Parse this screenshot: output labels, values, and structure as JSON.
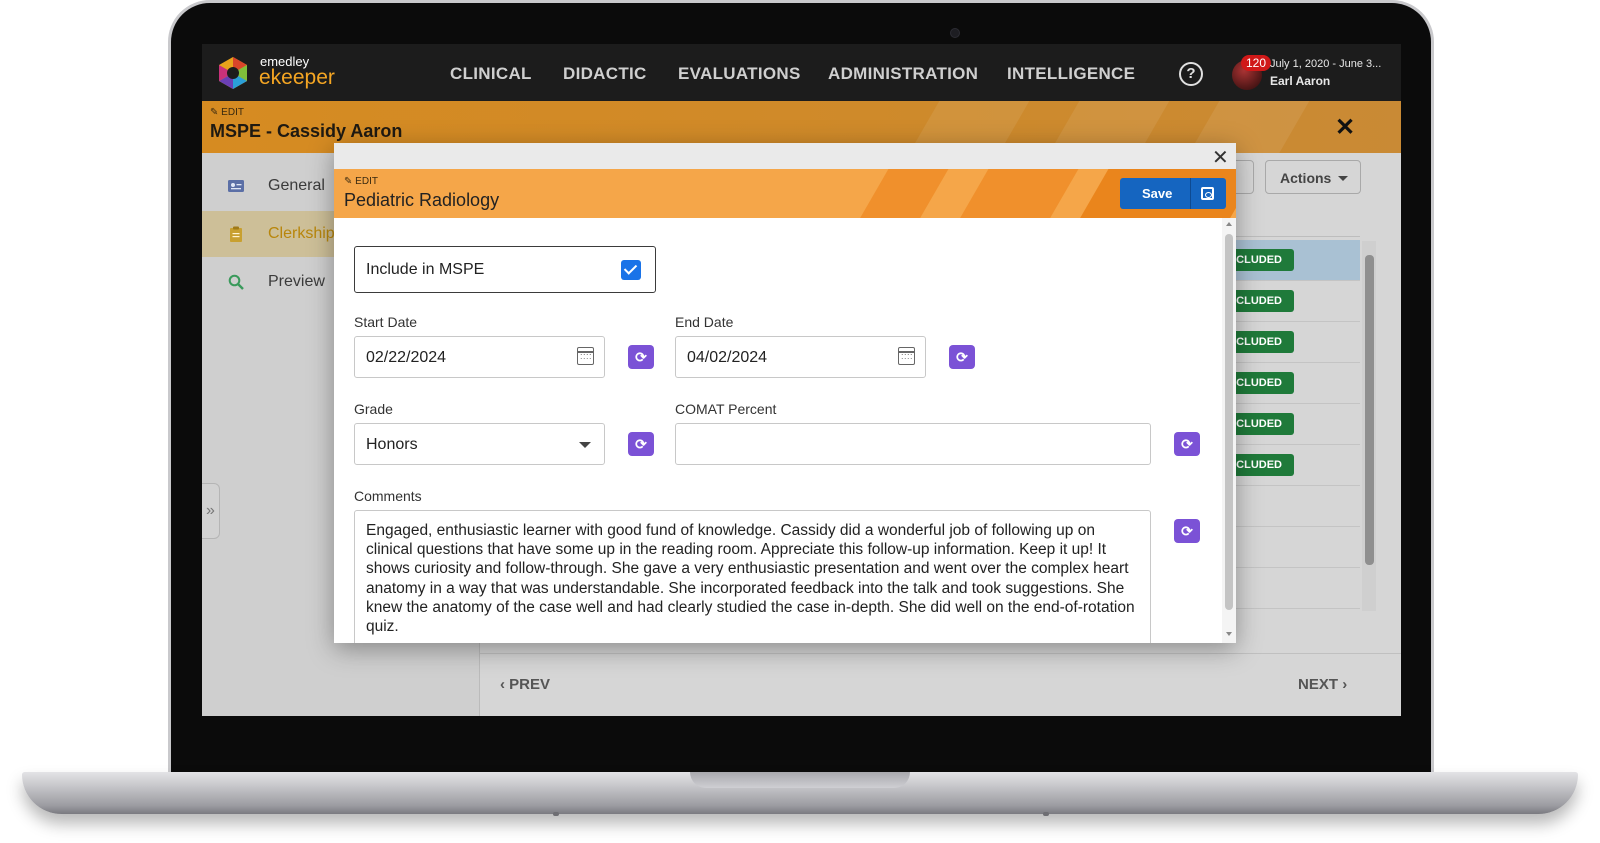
{
  "app": {
    "brand_top": "emedley",
    "brand_main": "ekeeper"
  },
  "nav": {
    "items": [
      "CLINICAL",
      "DIDACTIC",
      "EVALUATIONS",
      "ADMINISTRATION",
      "INTELLIGENCE"
    ],
    "help_icon": "?",
    "notification_count": "120",
    "date_range": "July 1, 2020 - June 3...",
    "user_name": "Earl Aaron"
  },
  "page": {
    "edit_tag": "EDIT",
    "title": "MSPE - Cassidy Aaron",
    "close_icon": "✕"
  },
  "sidebar": {
    "items": [
      {
        "label": "General",
        "icon": "id-card-icon"
      },
      {
        "label": "Clerkships",
        "icon": "clipboard-icon"
      },
      {
        "label": "Preview",
        "icon": "search-icon"
      }
    ],
    "collapse_icon": "»"
  },
  "main": {
    "actions_label": "Actions",
    "badges": [
      "INCLUDED",
      "INCLUDED",
      "INCLUDED",
      "INCLUDED",
      "INCLUDED",
      "INCLUDED"
    ],
    "prev_label": "PREV",
    "next_label": "NEXT",
    "prev_icon": "‹",
    "next_icon": "›"
  },
  "modal": {
    "close_icon": "✕",
    "edit_tag": "EDIT",
    "title": "Pediatric Radiology",
    "save_label": "Save",
    "include_label": "Include in MSPE",
    "include_checked": true,
    "start_date_label": "Start Date",
    "start_date": "02/22/2024",
    "end_date_label": "End Date",
    "end_date": "04/02/2024",
    "grade_label": "Grade",
    "grade_value": "Honors",
    "comat_label": "COMAT Percent",
    "comat_value": "",
    "comments_label": "Comments",
    "comments": "Engaged, enthusiastic learner with good fund of knowledge. Cassidy did a wonderful job of following up on clinical questions that have some up in the reading room. Appreciate this follow-up information. Keep it up! It shows curiosity  and follow-through. She gave a very enthusiastic presentation and went over the complex heart anatomy in a way that  was understandable. She incorporated feedback into the talk and took suggestions. She knew the anatomy of the case well and had clearly studied the case in-depth. She did well on the end-of-rotation quiz.",
    "sync_icon": "⟳"
  },
  "colors": {
    "accent_orange": "#f5a649",
    "header_orange": "#d68b21",
    "save_blue": "#1565c0",
    "sync_purple": "#7b52d6",
    "included_green": "#1f7a3a",
    "checkbox_blue": "#1a73e8"
  }
}
